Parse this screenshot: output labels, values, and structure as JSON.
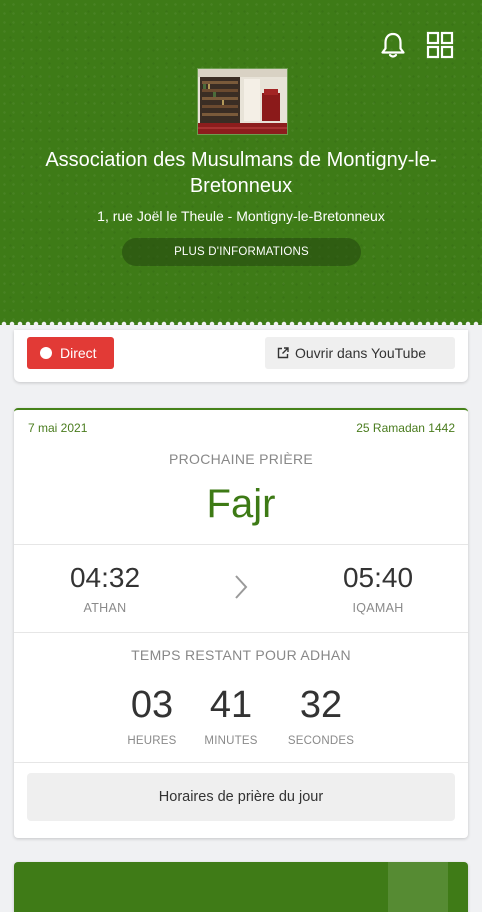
{
  "header": {
    "mosque_name": "Association des Musulmans de Montigny-le-Bretonneux",
    "address": "1, rue Joël le Theule - Montigny-le-Bretonneux",
    "more_info_label": "PLUS D'INFORMATIONS",
    "icons": [
      "bell-icon",
      "grid-icon"
    ],
    "accent_color": "#3e7b17"
  },
  "live": {
    "direct_label": "Direct",
    "youtube_label": "Ouvrir dans YouTube",
    "direct_color": "#e23a36"
  },
  "prayer": {
    "gregorian_date": "7 mai 2021",
    "hijri_date": "25 Ramadan 1442",
    "next_label": "PROCHAINE PRIÈRE",
    "next_name": "Fajr",
    "athan_time": "04:32",
    "athan_label": "ATHAN",
    "iqamah_time": "05:40",
    "iqamah_label": "IQAMAH",
    "remaining_label": "TEMPS RESTANT POUR ADHAN",
    "countdown": [
      {
        "value": "03",
        "unit": "HEURES"
      },
      {
        "value": "41",
        "unit": "MINUTES"
      },
      {
        "value": "32",
        "unit": "SECONDES"
      }
    ],
    "schedule_button": "Horaires de prière du jour"
  }
}
